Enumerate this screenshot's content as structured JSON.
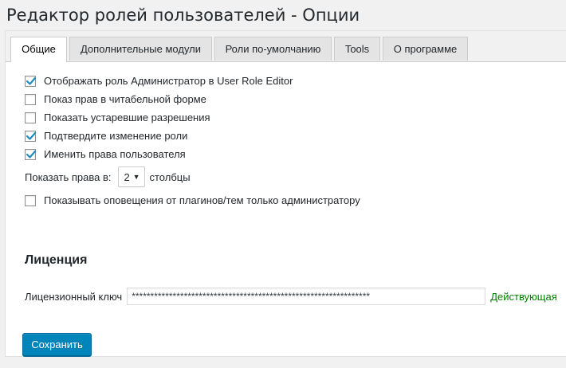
{
  "page": {
    "title": "Редактор ролей пользователей - Опции"
  },
  "tabs": [
    {
      "label": "Общие",
      "active": true
    },
    {
      "label": "Дополнительные модули",
      "active": false
    },
    {
      "label": "Роли по-умолчанию",
      "active": false
    },
    {
      "label": "Tools",
      "active": false
    },
    {
      "label": "О программе",
      "active": false
    }
  ],
  "general": {
    "options": [
      {
        "label": "Отображать роль Администратор в User Role Editor",
        "checked": true
      },
      {
        "label": "Показ прав в читабельной форме",
        "checked": false
      },
      {
        "label": "Показать устаревшие разрешения",
        "checked": false
      },
      {
        "label": "Подтвердите изменение роли",
        "checked": true
      },
      {
        "label": "Именить права пользователя",
        "checked": true
      }
    ],
    "columns": {
      "label": "Показать права в:",
      "value": "2",
      "suffix": "столбцы"
    },
    "notices_option": {
      "label": "Показывать оповещения от плагинов/тем только администратору",
      "checked": false
    }
  },
  "license": {
    "heading": "Лиценция",
    "key_label": "Лицензионный ключ",
    "key_value": "****************************************************************",
    "status": "Действующая",
    "status_color": "#008000"
  },
  "actions": {
    "save_label": "Сохранить",
    "accent": "#0085ba"
  }
}
